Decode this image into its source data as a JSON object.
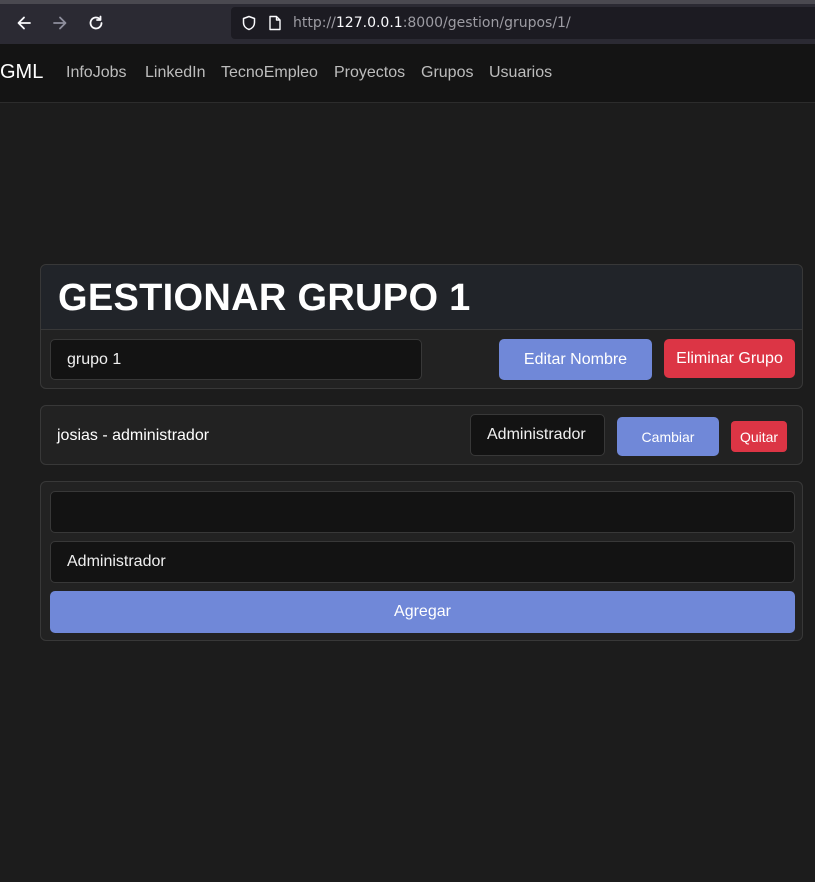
{
  "browser": {
    "url_scheme": "http://",
    "url_host": "127.0.0.1",
    "url_rest": ":8000/gestion/grupos/1/"
  },
  "navbar": {
    "brand": "GML",
    "links": [
      "InfoJobs",
      "LinkedIn",
      "TecnoEmpleo",
      "Proyectos",
      "Grupos",
      "Usuarios"
    ]
  },
  "group_card": {
    "title": "GESTIONAR GRUPO 1",
    "name_value": "grupo 1",
    "edit_button": "Editar Nombre",
    "delete_button": "Eliminar Grupo"
  },
  "member": {
    "label": "josias - administrador",
    "role_value": "Administrador",
    "change_button": "Cambiar",
    "remove_button": "Quitar"
  },
  "add_form": {
    "user_value": "",
    "role_value": "Administrador",
    "add_button": "Agregar"
  },
  "colors": {
    "primary": "#7088d8",
    "danger": "#dc3545",
    "background": "#1c1c1c"
  }
}
